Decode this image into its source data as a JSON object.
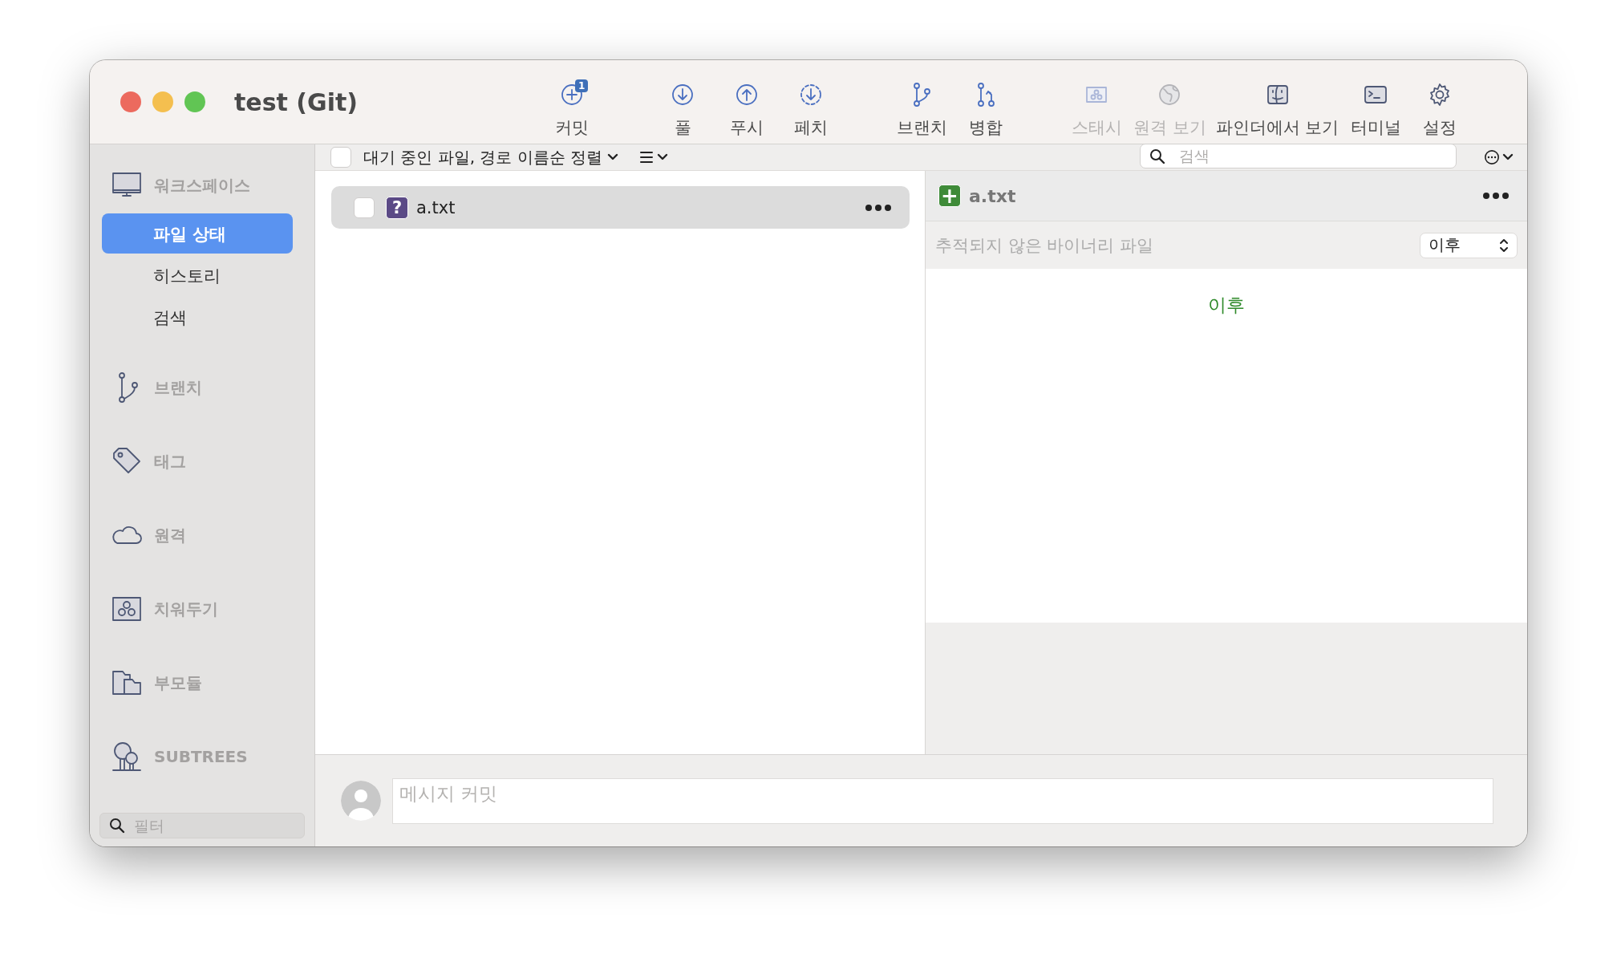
{
  "window": {
    "title": "test (Git)"
  },
  "toolbar": {
    "groups": [
      [
        {
          "label": "커밋",
          "badge": "1",
          "disabled": false
        }
      ],
      [
        {
          "label": "풀",
          "disabled": false
        },
        {
          "label": "푸시",
          "disabled": false
        },
        {
          "label": "페치",
          "disabled": false
        }
      ],
      [
        {
          "label": "브랜치",
          "disabled": false
        },
        {
          "label": "병합",
          "disabled": false
        }
      ],
      [
        {
          "label": "스태시",
          "disabled": true
        },
        {
          "label": "원격 보기",
          "disabled": true
        },
        {
          "label": "파인더에서 보기",
          "disabled": false
        },
        {
          "label": "터미널",
          "disabled": false
        },
        {
          "label": "설정",
          "disabled": false
        }
      ]
    ]
  },
  "sidebar": {
    "sections": [
      {
        "label": "워크스페이스",
        "children": [
          {
            "label": "파일 상태",
            "selected": true
          },
          {
            "label": "히스토리",
            "selected": false
          },
          {
            "label": "검색",
            "selected": false
          }
        ]
      },
      {
        "label": "브랜치"
      },
      {
        "label": "태그"
      },
      {
        "label": "원격"
      },
      {
        "label": "치워두기"
      },
      {
        "label": "부모듈"
      },
      {
        "label": "SUBTREES"
      }
    ],
    "filter": {
      "placeholder": "필터"
    }
  },
  "file_list": {
    "header": {
      "checked": false,
      "sort_label": "대기 중인 파일, 경로 이름순 정렬"
    },
    "files": [
      {
        "name": "a.txt",
        "checked": false,
        "selected": true,
        "kind": "untracked",
        "glyph": "?"
      }
    ]
  },
  "search": {
    "placeholder": "검색"
  },
  "diff": {
    "file": {
      "name": "a.txt",
      "kind": "added",
      "glyph": "+"
    },
    "message": "추적되지 않은 바이너리 파일",
    "version_select": "이후",
    "side_label": "이후"
  },
  "commit": {
    "placeholder": "메시지 커밋"
  }
}
